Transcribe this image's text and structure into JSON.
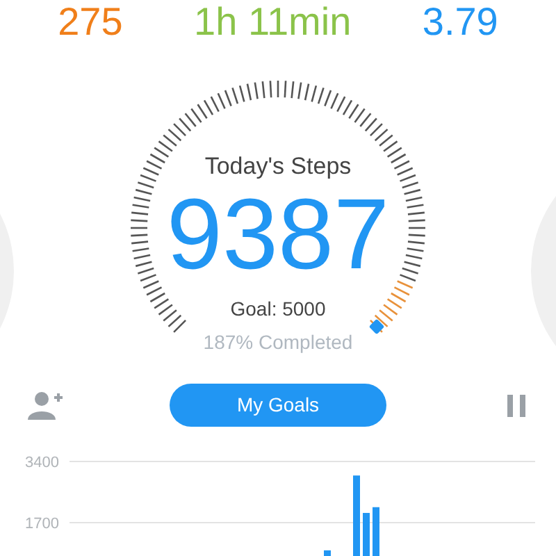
{
  "summary": [
    {
      "value": "275",
      "color": "#f07f1a"
    },
    {
      "value": "1h 11min",
      "color": "#8bc34a"
    },
    {
      "value": "3.79",
      "color": "#2196f3"
    }
  ],
  "steps": {
    "title": "Today's Steps",
    "count": "9387",
    "goal": "Goal: 5000",
    "completed": "187% Completed"
  },
  "goals_button": "My Goals",
  "chart_data": {
    "type": "bar",
    "values": [
      0,
      0,
      0,
      0,
      0,
      0,
      0,
      0,
      0,
      0,
      0,
      0,
      0,
      0,
      0,
      0,
      0,
      0,
      0,
      0,
      0,
      0,
      0,
      0,
      0,
      0,
      930,
      0,
      0,
      3010,
      1970,
      2130,
      0,
      0,
      0,
      0,
      0,
      0,
      0,
      0,
      0,
      0,
      0,
      0,
      0,
      0,
      0,
      0
    ],
    "yticks": [
      {
        "value": 1700,
        "label": "1700"
      },
      {
        "value": 3400,
        "label": "3400"
      }
    ],
    "ylim": [
      0,
      3400
    ]
  }
}
